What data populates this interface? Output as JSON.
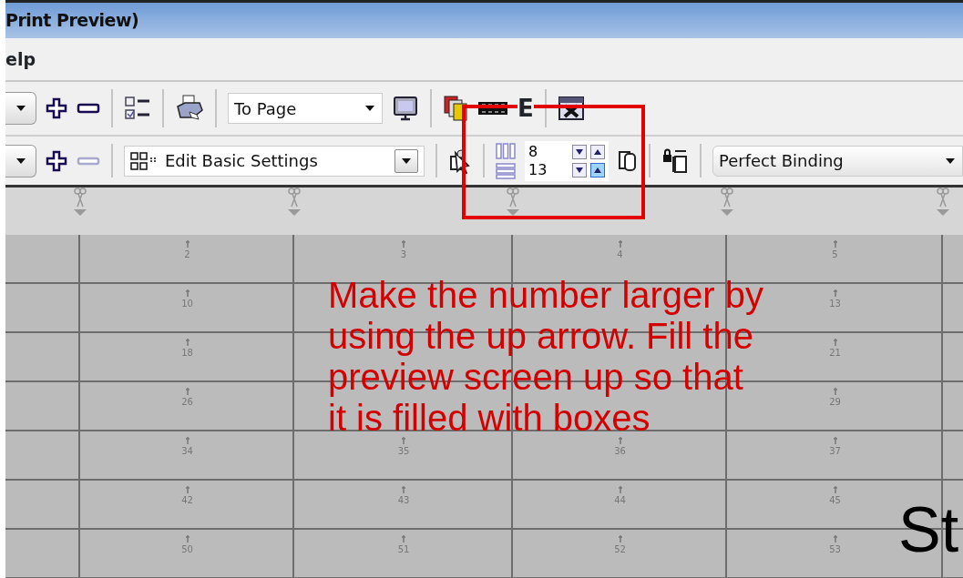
{
  "window": {
    "title": "Print Preview)"
  },
  "menu": [
    {
      "label": "elp"
    }
  ],
  "toolbar1": {
    "zoom_combo": {
      "value": "To Page"
    },
    "letter_button": {
      "label": "E"
    }
  },
  "toolbar2": {
    "minus_button": {
      "disabled": true
    },
    "style_combo": {
      "value": "Edit Basic Settings"
    },
    "columns_spinner": {
      "value": "8"
    },
    "rows_spinner": {
      "value": "13"
    },
    "binding_combo": {
      "value": "Perfect Binding"
    }
  },
  "preview": {
    "rows": [
      [
        "2",
        "3",
        "4",
        "5"
      ],
      [
        "10",
        null,
        null,
        "13"
      ],
      [
        "18",
        null,
        null,
        "21"
      ],
      [
        "26",
        null,
        null,
        "29"
      ],
      [
        "34",
        "35",
        "36",
        "37"
      ],
      [
        "42",
        "43",
        "44",
        "45"
      ],
      [
        "50",
        "51",
        "52",
        "53"
      ]
    ]
  },
  "annotation": {
    "lines": [
      "Make the number larger by",
      "using the up arrow. Fill the",
      "preview screen up so that",
      "it is filled with boxes"
    ]
  },
  "slide_text": "St"
}
